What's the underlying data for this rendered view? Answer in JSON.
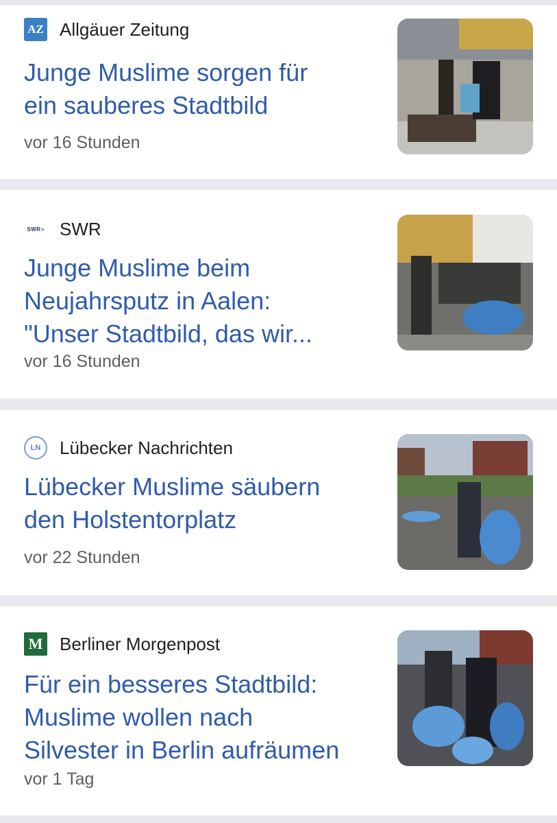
{
  "articles": [
    {
      "source": "Allgäuer Zeitung",
      "source_logo": "az-logo-icon",
      "logo_text": "AZ",
      "headline_lines": [
        "Junge Muslime sorgen für",
        "ein sauberes Stadtbild"
      ],
      "time": "vor 16 Stunden",
      "thumbnail": "news-photo-icon"
    },
    {
      "source": "SWR",
      "source_logo": "swr-logo-icon",
      "logo_text": "SWR",
      "headline_lines": [
        "Junge Muslime beim",
        "Neujahrsputz in Aalen:",
        "\"Unser Stadtbild, das wir..."
      ],
      "time": "vor 16 Stunden",
      "thumbnail": "news-photo-icon"
    },
    {
      "source": "Lübecker Nachrichten",
      "source_logo": "ln-logo-icon",
      "logo_text": "LN",
      "headline_lines": [
        "Lübecker Muslime säubern",
        "den Holstentorplatz"
      ],
      "time": "vor 22 Stunden",
      "thumbnail": "news-photo-icon"
    },
    {
      "source": "Berliner Morgenpost",
      "source_logo": "m-logo-icon",
      "logo_text": "M",
      "headline_lines": [
        "Für ein besseres Stadtbild:",
        "Muslime wollen nach",
        "Silvester in Berlin aufräumen"
      ],
      "time": "vor 1 Tag",
      "thumbnail": "news-photo-icon"
    }
  ],
  "colors": {
    "headline": "#2f5bab",
    "source": "#1f1f1f",
    "time": "#5f5f5f",
    "separator": "#e8e8ed",
    "az_logo": "#3d7fc4",
    "m_logo": "#1f6b3a"
  }
}
